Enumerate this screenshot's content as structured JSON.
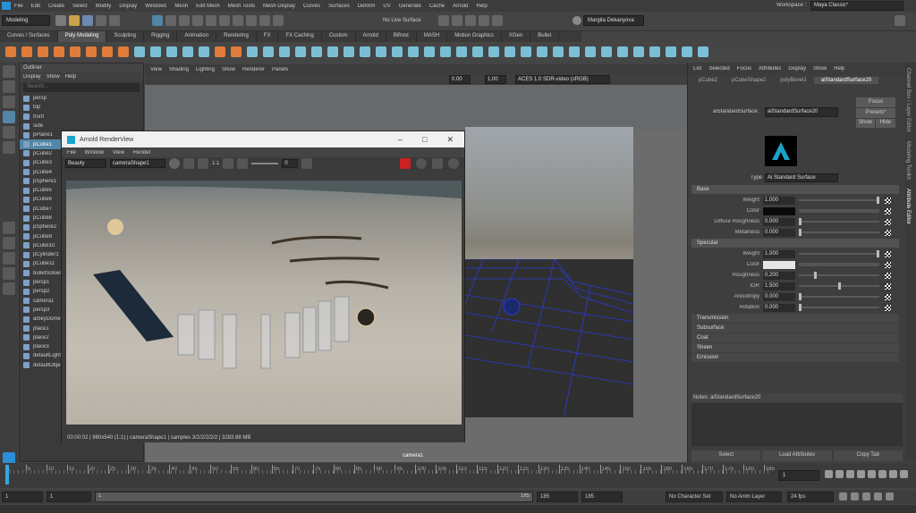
{
  "menus": [
    "File",
    "Edit",
    "Create",
    "Select",
    "Modify",
    "Display",
    "Windows",
    "Mesh",
    "Edit Mesh",
    "Mesh Tools",
    "Mesh Display",
    "Curves",
    "Surfaces",
    "Deform",
    "UV",
    "Generate",
    "Cache",
    "Arnold",
    "Help"
  ],
  "workspace": {
    "label": "Workspace :",
    "value": "Maya Classic*"
  },
  "status": {
    "mode": "Modeling",
    "live": "No Live Surface",
    "user": "Margita Dekanyova"
  },
  "shelf_tabs": [
    "Curves / Surfaces",
    "Poly Modeling",
    "Sculpting",
    "Rigging",
    "Animation",
    "Rendering",
    "FX",
    "FX Caching",
    "Custom",
    "Arnold",
    "Bifrost",
    "MASH",
    "Motion Graphics",
    "XGen",
    "Bullet"
  ],
  "shelf_active": "Poly Modeling",
  "outliner": {
    "title": "Outliner",
    "menus": [
      "Display",
      "Show",
      "Help"
    ],
    "search": "Search...",
    "items": [
      "persp",
      "top",
      "front",
      "side",
      "pPlane1",
      "pCube1",
      "pCube2",
      "pCube3",
      "pCube4",
      "pSphere1",
      "pCube5",
      "pCube6",
      "pCube7",
      "pCube8",
      "pSphere2",
      "pCube9",
      "pCube10",
      "pCylinder1",
      "pCube11",
      "bulletSolver1",
      "persp1",
      "persp2",
      "camera1",
      "persp3",
      "aiSkyDomeLight1",
      "place1",
      "place2",
      "place3",
      "defaultLightSet",
      "defaultObjectSet"
    ],
    "selected_index": 5
  },
  "viewport": {
    "menus": [
      "View",
      "Shading",
      "Lighting",
      "Show",
      "Renderer",
      "Panels"
    ],
    "exposure": "0.00",
    "gamma": "1.00",
    "colorspace": "ACES 1.0 SDR-video (sRGB)",
    "camera": "camera1"
  },
  "renderview": {
    "title": "Arnold RenderView",
    "menus": [
      "File",
      "Window",
      "View",
      "Render"
    ],
    "aov": "Beauty",
    "camera": "cameraShape1",
    "ratio": "1:1",
    "exposure": "0",
    "status": "00:00:02 | 960x540 (1:1) | cameraShape1 | samples 3/2/2/2/2/2 | 3283.88 MB"
  },
  "attr": {
    "menus": [
      "List",
      "Selected",
      "Focus",
      "Attributes",
      "Display",
      "Show",
      "Help"
    ],
    "tabs": [
      "pCube2",
      "pCubeShape2",
      "polyBevel1",
      "aiStandardSurface20"
    ],
    "active_tab": "aiStandardSurface20",
    "node_label": "aiStandardSurface:",
    "node_value": "aiStandardSurface20",
    "focus": "Focus",
    "presets": "Presets*",
    "show": "Show",
    "hide": "Hide",
    "type_label": "Type",
    "type_value": "Ai Standard Surface",
    "base": "Base",
    "specular": "Specular",
    "base_rows": [
      {
        "label": "Weight",
        "value": "1.000",
        "pos": 1.0
      },
      {
        "label": "Color",
        "value": "",
        "color": "#0a0a0a"
      },
      {
        "label": "Diffuse Roughness",
        "value": "0.000",
        "pos": 0.0
      },
      {
        "label": "Metalness",
        "value": "0.000",
        "pos": 0.0
      }
    ],
    "spec_rows": [
      {
        "label": "Weight",
        "value": "1.000",
        "pos": 1.0
      },
      {
        "label": "Color",
        "value": "",
        "color": "#e6e6e6"
      },
      {
        "label": "Roughness",
        "value": "0.200",
        "pos": 0.2
      },
      {
        "label": "IOR",
        "value": "1.500",
        "pos": 0.5
      },
      {
        "label": "Anisotropy",
        "value": "0.000",
        "pos": 0.0
      },
      {
        "label": "Rotation",
        "value": "0.000",
        "pos": 0.0
      }
    ],
    "collapsed": [
      "Transmission",
      "Subsurface",
      "Coat",
      "Sheen",
      "Emission"
    ],
    "notes": "Notes: aiStandardSurface20",
    "buttons": [
      "Select",
      "Load Attributes",
      "Copy Tab"
    ]
  },
  "side_tabs": [
    "Channel Box / Layer Editor",
    "Modeling Toolkit",
    "Attribute Editor"
  ],
  "timeline": {
    "ticks": [
      "1",
      "5",
      "10",
      "15",
      "20",
      "25",
      "30",
      "35",
      "40",
      "45",
      "50",
      "55",
      "60",
      "65",
      "70",
      "75",
      "80",
      "85",
      "90",
      "95",
      "100",
      "105",
      "110",
      "115",
      "120",
      "125",
      "130",
      "135",
      "140",
      "145",
      "150",
      "155",
      "160",
      "165",
      "170",
      "175",
      "180",
      "185"
    ],
    "current": "1"
  },
  "range": {
    "start": "1",
    "inner_start": "1",
    "left_box": "1",
    "inner_end": "185",
    "end1": "185",
    "end2": "185",
    "character": "No Character Set",
    "anim_layer": "No Anim Layer",
    "fps": "24 fps"
  }
}
